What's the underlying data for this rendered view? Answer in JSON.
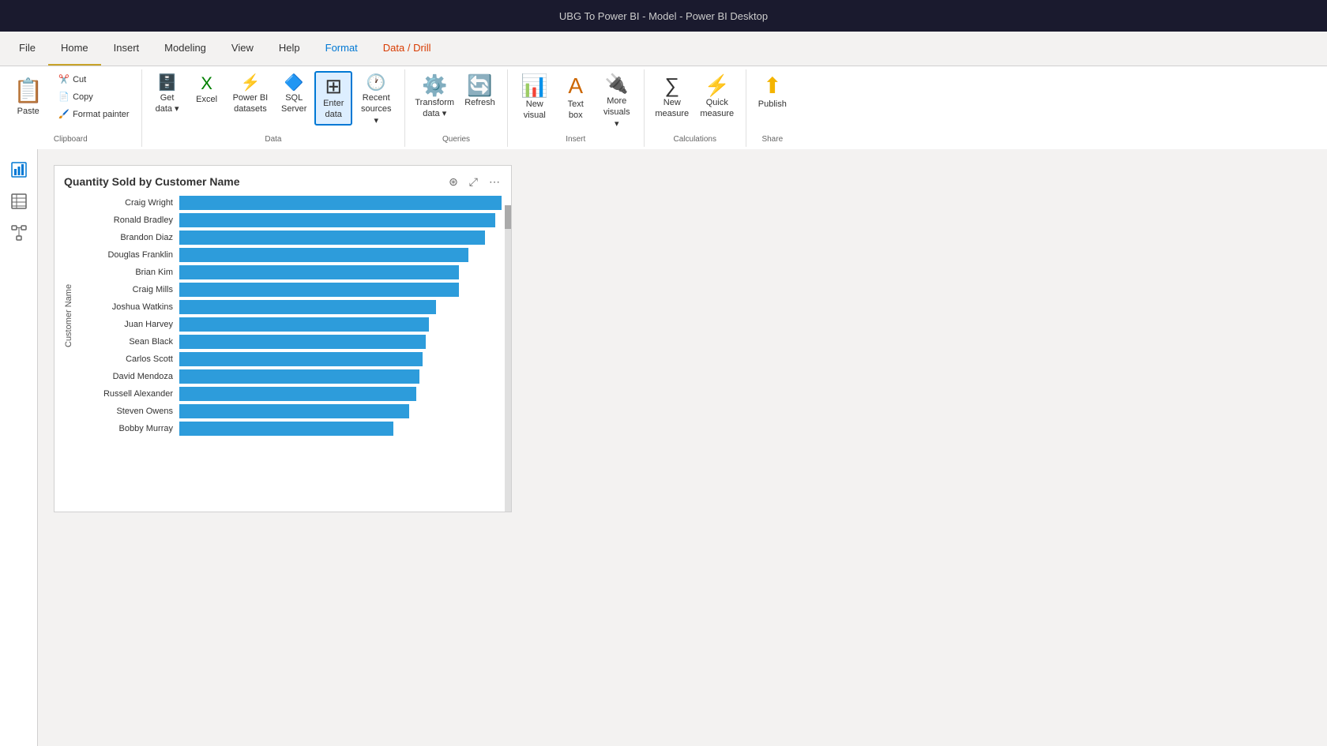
{
  "titlebar": {
    "text": "UBG To Power BI - Model - Power BI Desktop"
  },
  "menu": {
    "items": [
      {
        "id": "file",
        "label": "File",
        "active": false
      },
      {
        "id": "home",
        "label": "Home",
        "active": true
      },
      {
        "id": "insert",
        "label": "Insert",
        "active": false
      },
      {
        "id": "modeling",
        "label": "Modeling",
        "active": false
      },
      {
        "id": "view",
        "label": "View",
        "active": false
      },
      {
        "id": "help",
        "label": "Help",
        "active": false
      },
      {
        "id": "format",
        "label": "Format",
        "active": false,
        "colored": true
      },
      {
        "id": "data-drill",
        "label": "Data / Drill",
        "active": false,
        "colored2": true
      }
    ]
  },
  "ribbon": {
    "groups": [
      {
        "id": "clipboard",
        "label": "Clipboard",
        "buttons": [
          {
            "id": "paste",
            "label": "Paste",
            "icon": "📋",
            "large": true
          },
          {
            "id": "cut",
            "label": "Cut",
            "icon": "✂️",
            "small": true
          },
          {
            "id": "copy",
            "label": "Copy",
            "icon": "📄",
            "small": true
          },
          {
            "id": "format-painter",
            "label": "Format painter",
            "icon": "🖌️",
            "small": true
          }
        ]
      },
      {
        "id": "data",
        "label": "Data",
        "buttons": [
          {
            "id": "get-data",
            "label": "Get data",
            "icon": "🗄️",
            "dropdown": true
          },
          {
            "id": "excel",
            "label": "Excel",
            "icon": "📗"
          },
          {
            "id": "power-bi-datasets",
            "label": "Power BI datasets",
            "icon": "⚡"
          },
          {
            "id": "sql-server",
            "label": "SQL Server",
            "icon": "🔷"
          },
          {
            "id": "enter-data",
            "label": "Enter data",
            "icon": "📊",
            "active": true
          },
          {
            "id": "recent-sources",
            "label": "Recent sources",
            "icon": "🕐",
            "dropdown": true
          }
        ]
      },
      {
        "id": "queries",
        "label": "Queries",
        "buttons": [
          {
            "id": "transform-data",
            "label": "Transform data",
            "icon": "⚙️",
            "dropdown": true
          },
          {
            "id": "refresh",
            "label": "Refresh",
            "icon": "🔄"
          }
        ]
      },
      {
        "id": "insert",
        "label": "Insert",
        "buttons": [
          {
            "id": "new-visual",
            "label": "New visual",
            "icon": "📊"
          },
          {
            "id": "text-box",
            "label": "Text box",
            "icon": "🅰"
          },
          {
            "id": "more-visuals",
            "label": "More visuals",
            "icon": "🔌",
            "dropdown": true
          }
        ]
      },
      {
        "id": "calculations",
        "label": "Calculations",
        "buttons": [
          {
            "id": "new-measure",
            "label": "New measure",
            "icon": "∑"
          },
          {
            "id": "quick-measure",
            "label": "Quick measure",
            "icon": "⚡"
          }
        ]
      },
      {
        "id": "share",
        "label": "Share",
        "buttons": [
          {
            "id": "publish",
            "label": "Publish",
            "icon": "☁️"
          }
        ]
      }
    ]
  },
  "sidebar": {
    "items": [
      {
        "id": "report",
        "icon": "📊",
        "active": true
      },
      {
        "id": "data",
        "icon": "⊞",
        "active": false
      },
      {
        "id": "model",
        "icon": "⬡",
        "active": false
      }
    ]
  },
  "chart": {
    "title": "Quantity Sold by Customer Name",
    "yAxisLabel": "Customer Name",
    "bars": [
      {
        "label": "Craig Wright",
        "value": 98
      },
      {
        "label": "Ronald Bradley",
        "value": 96
      },
      {
        "label": "Brandon Diaz",
        "value": 93
      },
      {
        "label": "Douglas Franklin",
        "value": 88
      },
      {
        "label": "Brian Kim",
        "value": 85
      },
      {
        "label": "Craig Mills",
        "value": 85
      },
      {
        "label": "Joshua Watkins",
        "value": 78
      },
      {
        "label": "Juan Harvey",
        "value": 76
      },
      {
        "label": "Sean Black",
        "value": 75
      },
      {
        "label": "Carlos Scott",
        "value": 74
      },
      {
        "label": "David Mendoza",
        "value": 73
      },
      {
        "label": "Russell Alexander",
        "value": 72
      },
      {
        "label": "Steven Owens",
        "value": 70
      },
      {
        "label": "Bobby Murray",
        "value": 65
      }
    ],
    "barColor": "#2d9cdb"
  }
}
